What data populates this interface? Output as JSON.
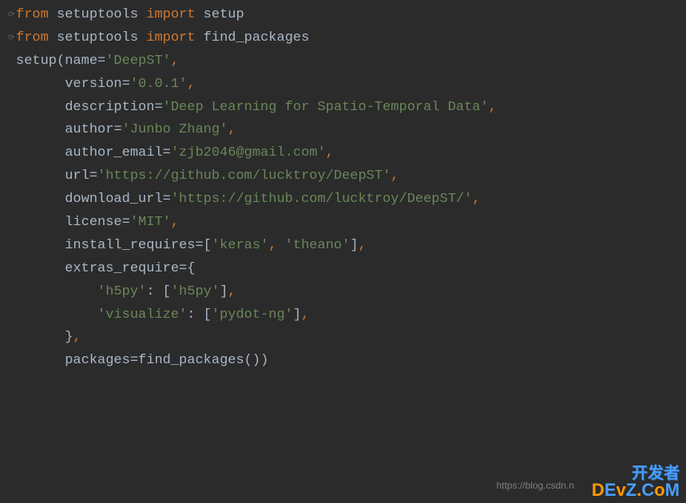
{
  "code": {
    "line1": {
      "from": "from",
      "module": "setuptools",
      "import": "import",
      "name": "setup"
    },
    "line2": {
      "from": "from",
      "module": "setuptools",
      "import": "import",
      "name": "find_packages"
    },
    "setup_call": "setup",
    "params": {
      "name_key": "name",
      "name_val": "'DeepST'",
      "version_key": "version",
      "version_val": "'0.0.1'",
      "description_key": "description",
      "description_val": "'Deep Learning for Spatio-Temporal Data'",
      "author_key": "author",
      "author_val": "'Junbo Zhang'",
      "author_email_key": "author_email",
      "author_email_val": "'zjb2046@gmail.com'",
      "url_key": "url",
      "url_val": "'https://github.com/lucktroy/DeepST'",
      "download_url_key": "download_url",
      "download_url_val": "'https://github.com/lucktroy/DeepST/'",
      "license_key": "license",
      "license_val": "'MIT'",
      "install_requires_key": "install_requires",
      "install_requires_val1": "'keras'",
      "install_requires_val2": "'theano'",
      "extras_require_key": "extras_require",
      "extras_h5py_key": "'h5py'",
      "extras_h5py_val": "'h5py'",
      "extras_visualize_key": "'visualize'",
      "extras_visualize_val": "'pydot-ng'",
      "packages_key": "packages",
      "packages_func": "find_packages"
    }
  },
  "watermark": {
    "url": "https://blog.csdn.n",
    "logo_cn": "开发者",
    "logo_en_chars": [
      "D",
      "E",
      "v",
      "Z",
      ".",
      "C",
      "o",
      "M"
    ]
  }
}
